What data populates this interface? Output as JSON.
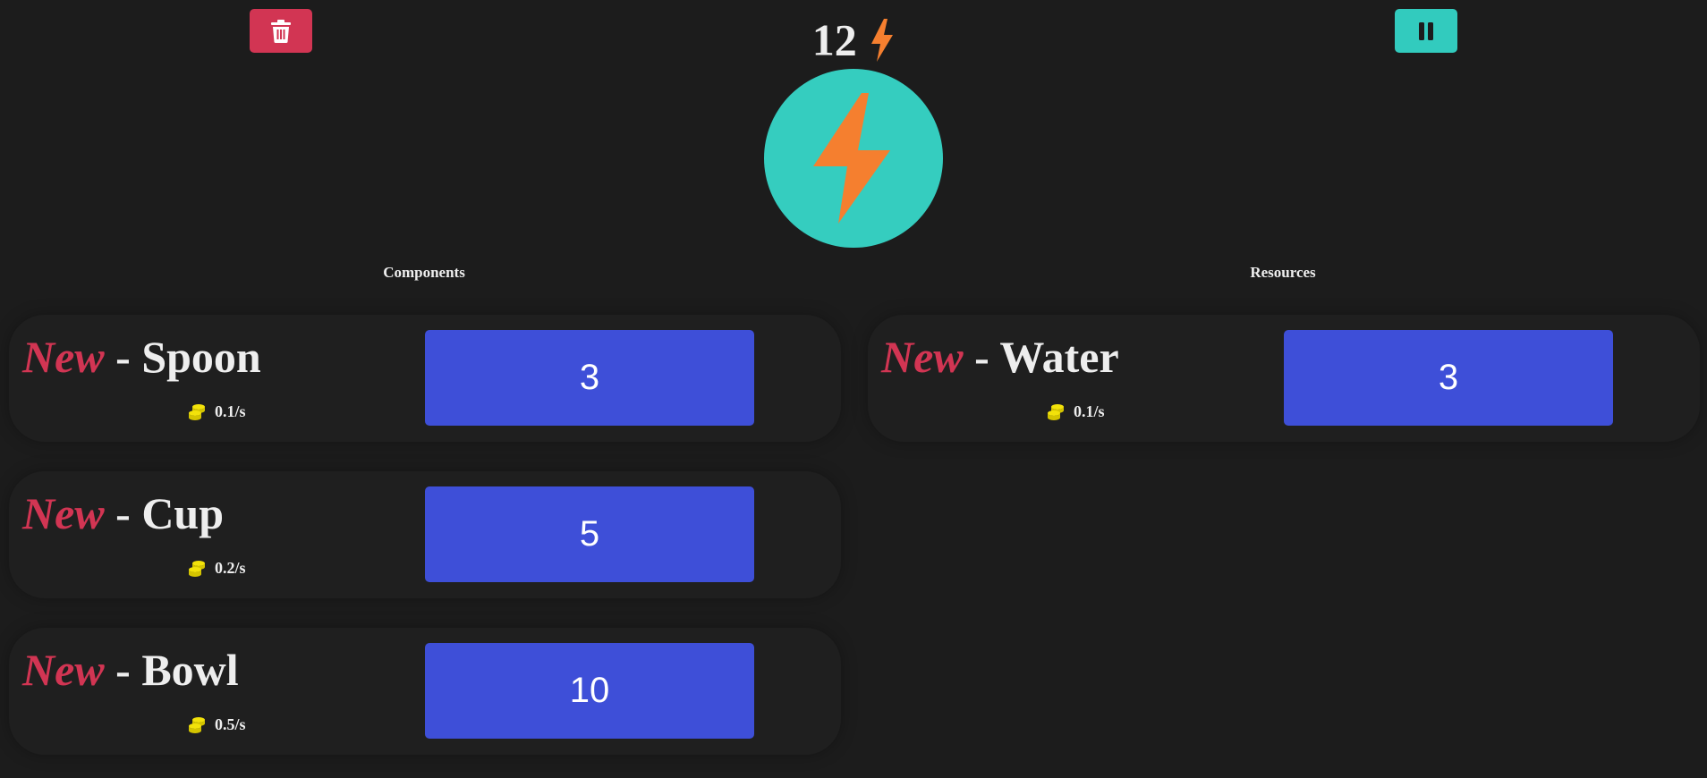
{
  "header": {
    "energy_value": "12",
    "energy_icon": "lightning-bolt-icon",
    "trash_icon": "trash-icon",
    "pause_icon": "pause-icon",
    "big_button_icon": "lightning-bolt-icon"
  },
  "colors": {
    "background": "#1c1c1c",
    "danger": "#d23553",
    "teal": "#32cbbe",
    "bolt_orange": "#f57f2f",
    "buy_blue": "#3e4fd8",
    "coin_yellow": "#f2e20a"
  },
  "components": {
    "title": "Components",
    "items": [
      {
        "tag": "New",
        "sep": " - ",
        "name": "Spoon",
        "rate": "0.1/s",
        "cost": "3"
      },
      {
        "tag": "New",
        "sep": " - ",
        "name": "Cup",
        "rate": "0.2/s",
        "cost": "5"
      },
      {
        "tag": "New",
        "sep": " - ",
        "name": "Bowl",
        "rate": "0.5/s",
        "cost": "10"
      }
    ]
  },
  "resources": {
    "title": "Resources",
    "items": [
      {
        "tag": "New",
        "sep": " - ",
        "name": "Water",
        "rate": "0.1/s",
        "cost": "3"
      }
    ]
  }
}
